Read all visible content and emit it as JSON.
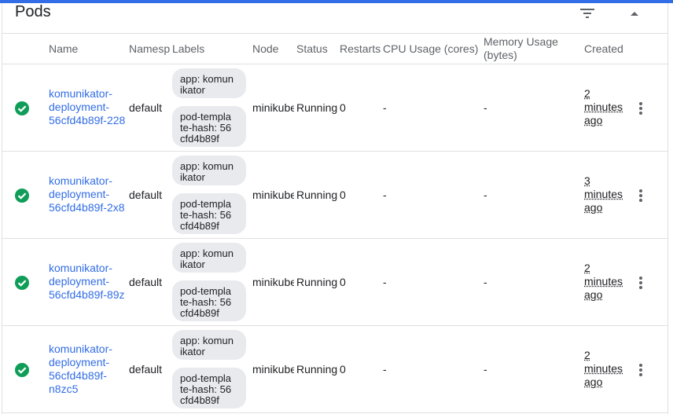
{
  "accent_color": "#326de6",
  "status_color": "#0f9d58",
  "card": {
    "title": "Pods",
    "filter_icon": "filter-icon",
    "collapse_icon": "collapse-icon"
  },
  "columns": {
    "name": "Name",
    "namespace": "Namesp",
    "labels": "Labels",
    "node": "Node",
    "status": "Status",
    "restarts": "Restarts",
    "cpu": "CPU Usage (cores)",
    "memory_line1": "Memory Usage",
    "memory_line2": "(bytes)",
    "created": "Created"
  },
  "rows": [
    {
      "name": "komunikator-\ndeployment-\n56cfd4b89f-228",
      "namespace": "default",
      "label1": "app: komun\nikator",
      "label2": "pod-templa\nte-hash: 56\ncfd4b89f",
      "node": "minikube",
      "status": "Running",
      "restarts": "0",
      "cpu": "-",
      "memory": "-",
      "created": "2\nminutes\nago"
    },
    {
      "name": "komunikator-\ndeployment-\n56cfd4b89f-2x8",
      "namespace": "default",
      "label1": "app: komun\nikator",
      "label2": "pod-templa\nte-hash: 56\ncfd4b89f",
      "node": "minikube",
      "status": "Running",
      "restarts": "0",
      "cpu": "-",
      "memory": "-",
      "created": "3\nminutes\nago"
    },
    {
      "name": "komunikator-\ndeployment-\n56cfd4b89f-89z",
      "namespace": "default",
      "label1": "app: komun\nikator",
      "label2": "pod-templa\nte-hash: 56\ncfd4b89f",
      "node": "minikube",
      "status": "Running",
      "restarts": "0",
      "cpu": "-",
      "memory": "-",
      "created": "2\nminutes\nago"
    },
    {
      "name": "komunikator-\ndeployment-\n56cfd4b89f-\nn8zc5",
      "namespace": "default",
      "label1": "app: komun\nikator",
      "label2": "pod-templa\nte-hash: 56\ncfd4b89f",
      "node": "minikube",
      "status": "Running",
      "restarts": "0",
      "cpu": "-",
      "memory": "-",
      "created": "2\nminutes\nago"
    }
  ]
}
